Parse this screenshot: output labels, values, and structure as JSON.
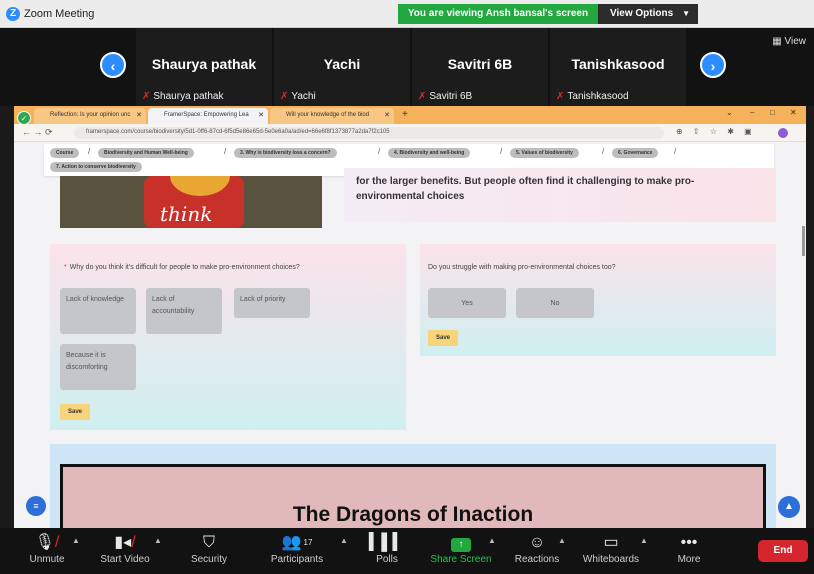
{
  "app": {
    "window_title": "Zoom Meeting",
    "viewing_banner": "You are viewing Ansh bansal's screen",
    "view_options": "View Options",
    "view_toggle": "View"
  },
  "participants": [
    {
      "name": "Shaurya pathak",
      "label": "Shaurya pathak"
    },
    {
      "name": "Yachi",
      "label": "Yachi"
    },
    {
      "name": "Savitri 6B",
      "label": "Savitri 6B"
    },
    {
      "name": "Tanishkasood",
      "label": "Tanishkasood"
    }
  ],
  "browser": {
    "tabs": [
      {
        "title": "Reflection: Is your opinion unc"
      },
      {
        "title": "FramerSpace: Empowering Lea"
      },
      {
        "title": "Will your knowledge of the biod"
      }
    ],
    "url": "framerspace.com/course/biodiversity/5d1-0ff6-87cd-6f5d5e86e65d-5e0e6a0a/ad/ed=66e6f8f1373877a2da7f2c105"
  },
  "breadcrumbs": [
    "Course",
    "Biodiversity and Human Well-being",
    "3. Why is biodiversity loss a concern?",
    "4. Biodiversity and well-being",
    "5. Values of biodiversity",
    "6. Governance",
    "7. Action to conserve biodiversity"
  ],
  "image": {
    "word": "think"
  },
  "top_card": {
    "text": "for the larger benefits. But people often find it challenging to make pro-environmental choices"
  },
  "left_card": {
    "question": "Why do you think it's difficult for people to make pro-environment choices?",
    "options": [
      "Lack of knowledge",
      "Lack of accountability",
      "Lack of priority",
      "Because it is discomforting"
    ],
    "save": "Save"
  },
  "right_card": {
    "question": "Do you struggle with making pro-environmental choices too?",
    "options": [
      "Yes",
      "No"
    ],
    "save": "Save"
  },
  "dragons": {
    "title": "The Dragons of Inaction"
  },
  "toolbar": {
    "unmute": "Unmute",
    "start_video": "Start Video",
    "security": "Security",
    "participants": "Participants",
    "participants_count": "17",
    "polls": "Polls",
    "share_screen": "Share Screen",
    "reactions": "Reactions",
    "whiteboards": "Whiteboards",
    "more": "More",
    "end": "End"
  },
  "colors": {
    "zoom_blue": "#2d8cff",
    "banner_green": "#23a83f",
    "end_red": "#d4262c",
    "save_yellow": "#f7d37a",
    "tab_orange": "#f6b25a"
  }
}
